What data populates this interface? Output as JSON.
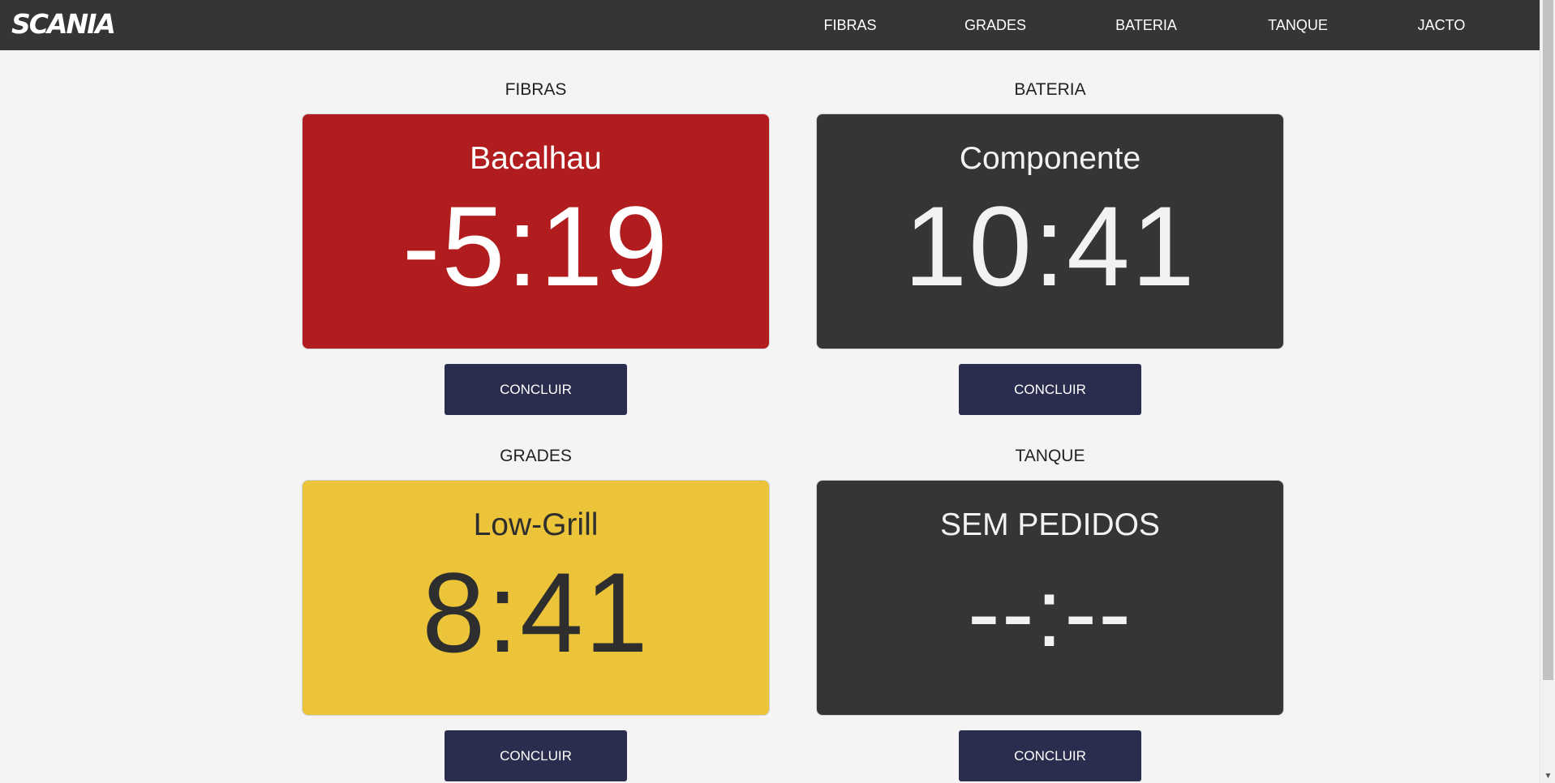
{
  "header": {
    "logo": "SCANIA",
    "nav": [
      "FIBRAS",
      "GRADES",
      "BATERIA",
      "TANQUE",
      "JACTO"
    ]
  },
  "panels": [
    {
      "title": "FIBRAS",
      "name": "Bacalhau",
      "time": "-5:19",
      "state": "overdue",
      "button": "CONCLUIR"
    },
    {
      "title": "BATERIA",
      "name": "Componente",
      "time": "10:41",
      "state": "normal",
      "button": "CONCLUIR"
    },
    {
      "title": "GRADES",
      "name": "Low-Grill",
      "time": "8:41",
      "state": "warning",
      "button": "CONCLUIR"
    },
    {
      "title": "TANQUE",
      "name": "SEM PEDIDOS",
      "time": "--:--",
      "state": "empty",
      "button": "CONCLUIR"
    }
  ],
  "colors": {
    "topbar": "#353535",
    "overdue": "#b11d1e",
    "normal": "#353535",
    "warning": "#ecc43a",
    "button": "#2b2d4e"
  }
}
